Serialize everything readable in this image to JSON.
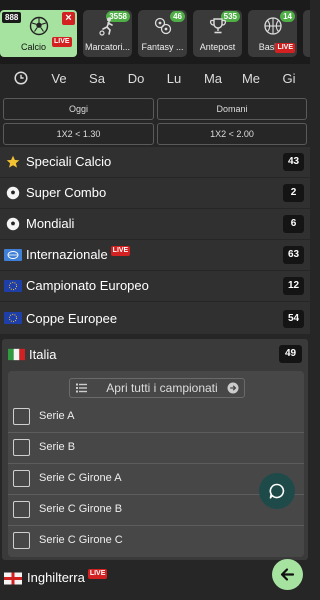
{
  "sports_tabs": {
    "active": {
      "label": "Calcio",
      "count": "888",
      "live": "LIVE",
      "close": "×",
      "icon": "soccer-ball-icon"
    },
    "tabs": [
      {
        "label": "Marcatori...",
        "count": "3558",
        "icon": "player-kick-icon"
      },
      {
        "label": "Fantasy ...",
        "count": "46",
        "icon": "balls-icon"
      },
      {
        "label": "Antepost",
        "count": "535",
        "icon": "trophy-icon"
      },
      {
        "label": "Basket",
        "count": "14",
        "live": "LIVE",
        "icon": "basketball-icon"
      }
    ]
  },
  "days": {
    "clock_icon": "clock-icon",
    "items": [
      "Ve",
      "Sa",
      "Do",
      "Lu",
      "Ma",
      "Me",
      "Gi"
    ]
  },
  "filters": {
    "today": "Oggi",
    "tomorrow": "Domani",
    "odds_low": "1X2 < 1.30",
    "odds_mid": "1X2 < 2.00"
  },
  "leagues": [
    {
      "name": "Speciali Calcio",
      "count": "43",
      "icon": "star-icon"
    },
    {
      "name": "Super Combo",
      "count": "2",
      "icon": "soccer-ball-icon"
    },
    {
      "name": "Mondiali",
      "count": "6",
      "icon": "soccer-ball-icon"
    },
    {
      "name": "Internazionale",
      "count": "63",
      "icon": "world-flag-icon",
      "live": "LIVE"
    },
    {
      "name": "Campionato Europeo",
      "count": "12",
      "icon": "eu-flag-icon"
    },
    {
      "name": "Coppe Europee",
      "count": "54",
      "icon": "eu-flag-icon"
    }
  ],
  "italia": {
    "name": "Italia",
    "count": "49",
    "icon": "italy-flag-icon",
    "open_all": "Apri tutti i campionati",
    "championships": [
      "Serie A",
      "Serie B",
      "Serie C Girone A",
      "Serie C Girone B",
      "Serie C Girone C"
    ]
  },
  "inghilterra": {
    "name": "Inghilterra",
    "live": "LIVE",
    "icon": "england-flag-icon"
  },
  "colors": {
    "accent_green": "#a7e3a0",
    "live_red": "#d32020",
    "badge_green": "#4fae46",
    "chat_teal": "#1e4a4a"
  }
}
